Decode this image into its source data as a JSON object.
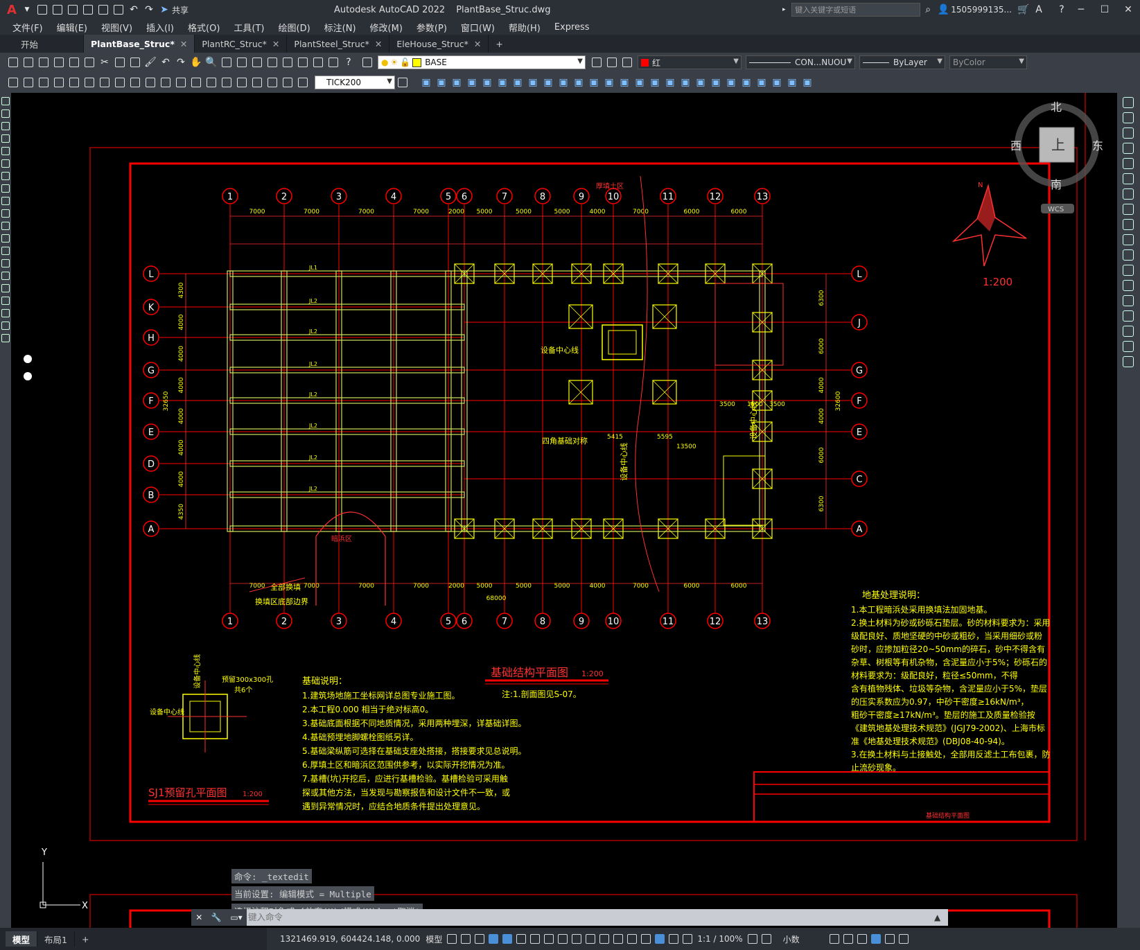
{
  "titlebar": {
    "app_logo": "A",
    "app_title": "Autodesk AutoCAD 2022",
    "file_name": "PlantBase_Struc.dwg",
    "share_label": "共享",
    "search_placeholder": "键入关键字或短语",
    "user": "1505999135...",
    "min": "─",
    "max": "☐",
    "close": "✕"
  },
  "menu": [
    "文件(F)",
    "编辑(E)",
    "视图(V)",
    "插入(I)",
    "格式(O)",
    "工具(T)",
    "绘图(D)",
    "标注(N)",
    "修改(M)",
    "参数(P)",
    "窗口(W)",
    "帮助(H)",
    "Express"
  ],
  "tabs": [
    {
      "label": "开始"
    },
    {
      "label": "PlantBase_Struc*"
    },
    {
      "label": "PlantRC_Struc*"
    },
    {
      "label": "PlantSteel_Struc*"
    },
    {
      "label": "EleHouse_Struc*"
    }
  ],
  "toolbar": {
    "layer": "BASE",
    "color": "红",
    "linetype": "CON...NUOU",
    "lineweight": "ByLayer",
    "plotstyle": "ByColor",
    "dimstyle": "TICK200"
  },
  "viewcube": {
    "north": "北",
    "south": "南",
    "east": "东",
    "west": "西",
    "top": "上",
    "wcs": "WCS"
  },
  "drawing": {
    "main_title": "基础结构平面图",
    "main_scale": "1:200",
    "note_line": "注:1.剖面图见S-07。",
    "sj1_title": "SJ1预留孔平面图",
    "sj1_scale": "1:200",
    "north_label": "N",
    "compass_scale": "1:200",
    "axes_top": [
      "1",
      "2",
      "3",
      "4",
      "5",
      "6",
      "7",
      "8",
      "9",
      "10",
      "11",
      "12",
      "13"
    ],
    "axes_left": [
      "L",
      "K",
      "H",
      "G",
      "F",
      "E",
      "D",
      "B",
      "A"
    ],
    "axes_right": [
      "L",
      "J",
      "G",
      "F",
      "E",
      "C",
      "A"
    ],
    "dims_top": [
      "7000",
      "7000",
      "7000",
      "7000",
      "2000",
      "5000",
      "5000",
      "5000",
      "4000",
      "7000",
      "6000",
      "6000"
    ],
    "dim_total": "68000",
    "dims_left": [
      "4300",
      "4000",
      "4000",
      "4000",
      "4000",
      "4000",
      "4000",
      "4350"
    ],
    "dim_left_total": "32650",
    "dims_right": [
      "6300",
      "6000",
      "4000",
      "4000",
      "6000",
      "6300"
    ],
    "dim_right_total": "32600",
    "beam_labels": [
      "JL1",
      "JL2",
      "JL2",
      "JL2",
      "JL2",
      "JL2",
      "JL2",
      "JL2"
    ],
    "labels": {
      "thick_fill": "厚填土区",
      "dark_creek": "暗浜区",
      "full_replace": "全部换填",
      "boundary": "换填区底部边界",
      "eq_center_1": "设备中心线",
      "eq_center_2": "设备中心线",
      "eq_center_3": "设备中心线",
      "corner_sym": "四角基础对称",
      "sj1_hole": "预留300x300孔",
      "sj1_count": "共6个",
      "sj1_center": "设备中心线",
      "dim_13500": "13500",
      "dim_5415": "5415",
      "dim_5595": "5595",
      "dim_3500a": "3500",
      "dim_1500": "1500",
      "dim_3500b": "3500"
    },
    "title_block": "基础结构平面图",
    "foundation_notes_title": "基础说明：",
    "foundation_notes": [
      "1.建筑场地施工坐标网详总图专业施工图。",
      "2.本工程0.000 相当于绝对标高0。",
      "3.基础底面根据不同地质情况，采用两种埋深，详基础详图。",
      "4.基础预埋地脚螺栓图纸另详。",
      "5.基础梁纵筋可选择在基础支座处搭接，搭接要求见总说明。",
      "6.厚填土区和暗浜区范围供参考，以实际开挖情况为准。",
      "7.基槽(坑)开挖后，应进行基槽检验。基槽检验可采用触",
      "  探或其他方法，当发现与勘察报告和设计文件不一致，或",
      "  遇到异常情况时，应结合地质条件提出处理意见。"
    ],
    "ground_notes_title": "地基处理说明：",
    "ground_notes": [
      "1.本工程暗浜处采用换填法加固地基。",
      "2.换土材料为砂或砂砾石垫层。砂的材料要求为：采用",
      "  级配良好、质地坚硬的中砂或粗砂，当采用细砂或粉",
      "  砂时，应掺加粒径20~50mm的碎石，砂中不得含有",
      "  杂草、树根等有机杂物，含泥量应小于5%；砂砾石的",
      "  材料要求为：级配良好，粒径≤50mm，不得",
      "  含有植物残体、垃圾等杂物，含泥量应小于5%，垫层",
      "  的压实系数应为0.97，中砂干密度≥16kN/m³，",
      "  粗砂干密度≥17kN/m³。垫层的施工及质量检验按",
      "  《建筑地基处理技术规范》(JGJ79-2002)、上海市标",
      "  准《地基处理技术规范》(DBJ08-40-94)。",
      "3.在换土材料与土接触处，全部用反滤土工布包裹，防",
      "  止流砂现象。"
    ]
  },
  "ucs": {
    "y": "Y",
    "x": "X"
  },
  "command": {
    "line1": "命令: _textedit",
    "line2": "当前设置: 编辑模式 = Multiple",
    "line3": "选择注释对象或 [放弃(U)/模式(M)]: *取消*",
    "placeholder": "键入命令"
  },
  "layout_tabs": [
    "模型",
    "布局1",
    "+"
  ],
  "status": {
    "coords": "1321469.919, 604424.148, 0.000",
    "model": "模型",
    "scale": "1:1 / 100%",
    "units": "小数"
  },
  "colors": {
    "red": "#ff0000",
    "yellow": "#ffff00",
    "beam": "#cfe35a",
    "bg": "#000000"
  }
}
